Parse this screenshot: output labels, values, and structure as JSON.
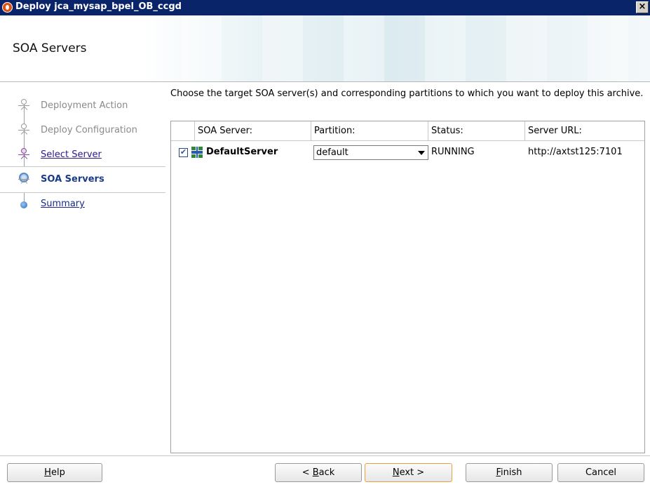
{
  "window": {
    "title": "Deploy jca_mysap_bpel_OB_ccgd",
    "close_label": "×"
  },
  "page": {
    "heading": "SOA Servers"
  },
  "nav": {
    "items": [
      {
        "label": "Deployment Action"
      },
      {
        "label": "Deploy Configuration"
      },
      {
        "label": "Select Server"
      },
      {
        "label": "SOA Servers"
      },
      {
        "label": "Summary"
      }
    ],
    "active_index": 3
  },
  "instructions": "Choose the target SOA server(s) and corresponding partitions to which you want to deploy this archive.",
  "table": {
    "columns": [
      "SOA Server:",
      "Partition:",
      "Status:",
      "Server URL:"
    ],
    "rows": [
      {
        "checked": true,
        "check_mark": "✔",
        "server": "DefaultServer",
        "partition": "default",
        "status": "RUNNING",
        "url": "http://axtst125:7101"
      }
    ]
  },
  "buttons": {
    "help": {
      "pre": "",
      "mn": "H",
      "post": "elp"
    },
    "back": {
      "pre": "< ",
      "mn": "B",
      "post": "ack"
    },
    "next": {
      "pre": "",
      "mn": "N",
      "post": "ext >"
    },
    "finish": {
      "pre": "",
      "mn": "F",
      "post": "inish"
    },
    "cancel": {
      "pre": "Cancel",
      "mn": "",
      "post": ""
    }
  },
  "colors": {
    "titlebar": "#0a246a",
    "active_nav_text": "#1a3a8a",
    "default_button_border": "#e8a040"
  }
}
